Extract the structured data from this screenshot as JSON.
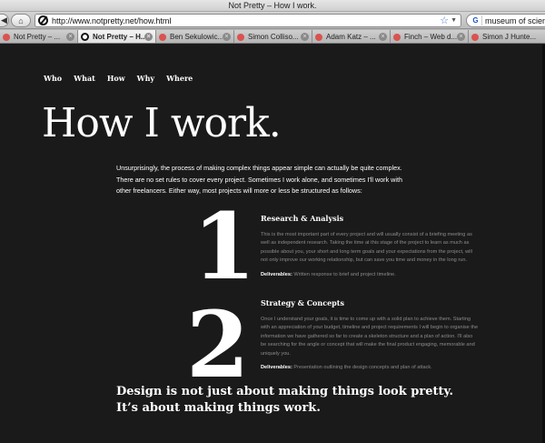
{
  "window": {
    "title": "Not Pretty – How I work."
  },
  "toolbar": {
    "url": "http://www.notpretty.net/how.html",
    "search_value": "museum of scien"
  },
  "tabs": [
    {
      "label": "Not Pretty – ..."
    },
    {
      "label": "Not Pretty – H..."
    },
    {
      "label": "Ben Sekulowic..."
    },
    {
      "label": "Simon Colliso..."
    },
    {
      "label": "Adam Katz – ..."
    },
    {
      "label": "Finch – Web d..."
    },
    {
      "label": "Simon J Hunte..."
    }
  ],
  "nav": {
    "who": "Who",
    "what": "What",
    "how": "How",
    "why": "Why",
    "where": "Where"
  },
  "page": {
    "title": "How I work.",
    "intro": "Unsurprisingly, the process of making complex things appear simple can actually be quite complex. There are no set rules to cover every project. Sometimes I work alone, and sometimes I'll work with other freelancers. Either way, most projects will more or less be structured as follows:",
    "steps": [
      {
        "number": "1",
        "title": "Research & Analysis",
        "body": "This is the most important part of every project and will usually consist of a briefing meeting as well as independent research. Taking the time at this stage of the project to learn as much as possible about you, your short and long term goals and your expectations from the project, will not only improve our working relationship, but can save you time and money in the long run.",
        "deliverables_label": "Deliverables:",
        "deliverables": "Written response to brief and project timeline."
      },
      {
        "number": "2",
        "title": "Strategy & Concepts",
        "body": "Once I understand your goals, it is time to come up with a solid plan to achieve them. Starting with an appreciation of your budget, timeline and project requirements I will begin to organise the information we have gathered so far to create a skeleton structure and a plan of action. I'll also be searching for the angle or concept that will make the final product engaging, memorable and uniquely you.",
        "deliverables_label": "Deliverables:",
        "deliverables": "Presentation outlining the design concepts and plan of attack."
      }
    ],
    "tagline_1": "Design is not just about making things look pretty.",
    "tagline_2": "It’s about making things work."
  },
  "colors": {
    "page_background": "#1a1a1a",
    "text": "#ffffff",
    "muted_text": "#8b8b8b"
  }
}
